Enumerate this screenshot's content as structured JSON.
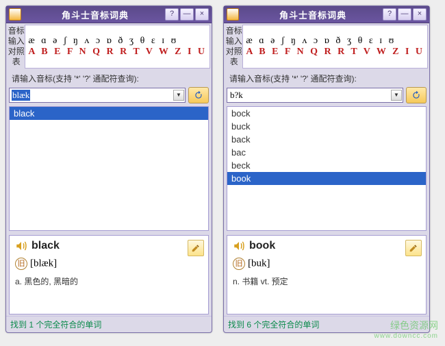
{
  "app": {
    "title": "角斗士音标词典",
    "toolbar_label_line1": "音标输入",
    "toolbar_label_line2": "对照表",
    "ipa_row": "æ ɑ ə ʃ ŋ ʌ ɔ ɒ ð ʒ θ ɛ ɪ ʊ",
    "map_row": "A B E F N Q R R T V W Z I U",
    "prompt": "请输入音标(支持 '*' '?' 通配符查询):",
    "win_buttons": {
      "help": "?",
      "min": "—",
      "close": "×"
    }
  },
  "windows": [
    {
      "search_value": "blæk",
      "search_selected": true,
      "results": [
        {
          "text": "black",
          "selected": true
        }
      ],
      "detail": {
        "word": "black",
        "badge": "旧",
        "pron": "[blæk]",
        "def": "a. 黑色的, 黑暗的"
      },
      "status": "找到 1 个完全符合的单词"
    },
    {
      "search_value": "b?k",
      "search_selected": false,
      "results": [
        {
          "text": "bock",
          "selected": false
        },
        {
          "text": "buck",
          "selected": false
        },
        {
          "text": "back",
          "selected": false
        },
        {
          "text": "bac",
          "selected": false
        },
        {
          "text": "beck",
          "selected": false
        },
        {
          "text": "book",
          "selected": true
        }
      ],
      "detail": {
        "word": "book",
        "badge": "旧",
        "pron": "[buk]",
        "def": "n. 书籍  vt. 预定"
      },
      "status": "找到 6 个完全符合的单词"
    }
  ],
  "watermark": {
    "line1": "绿色资源网",
    "line2": "www.downcc.com"
  }
}
